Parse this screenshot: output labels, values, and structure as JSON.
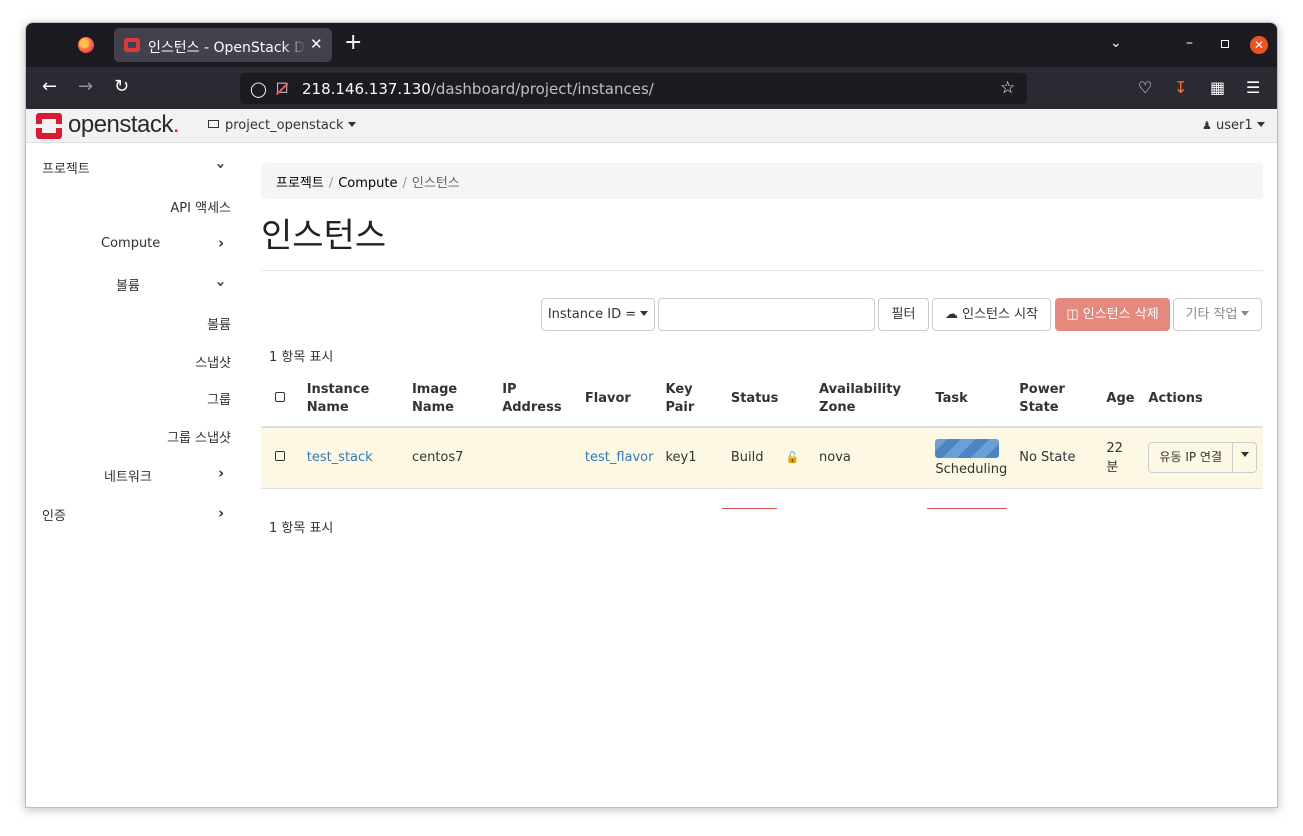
{
  "browser": {
    "tab_title": "인스턴스 - OpenStack Dashboard",
    "close_glyph": "✕",
    "new_tab_glyph": "+",
    "url_host": "218.146.137.130",
    "url_path": "/dashboard/project/instances/"
  },
  "header": {
    "logo": "openstack",
    "logo_dot": ".",
    "project": "project_openstack",
    "user": "user1"
  },
  "sidebar": {
    "project": "프로젝트",
    "api_access": "API 액세스",
    "compute": "Compute",
    "volumes_group": "볼륨",
    "volumes": "볼륨",
    "snapshots": "스냅샷",
    "groups": "그룹",
    "group_snapshots": "그룹 스냅샷",
    "network": "네트워크",
    "identity": "인증"
  },
  "breadcrumb": {
    "item1": "프로젝트",
    "item2": "Compute",
    "item3": "인스턴스",
    "sep": "/"
  },
  "page": {
    "title": "인스턴스",
    "filter_field": "Instance ID =",
    "filter_button": "필터",
    "launch_button": "인스턴스 시작",
    "delete_button": "인스턴스 삭제",
    "more_actions": "기타 작업",
    "count_top": "1 항목 표시",
    "count_bottom": "1 항목 표시"
  },
  "table": {
    "headers": {
      "instance_name": "Instance Name",
      "image_name": "Image Name",
      "ip_address": "IP Address",
      "flavor": "Flavor",
      "key_pair": "Key Pair",
      "status": "Status",
      "availability_zone": "Availability Zone",
      "task": "Task",
      "power_state": "Power State",
      "age": "Age",
      "actions": "Actions"
    },
    "rows": [
      {
        "instance_name": "test_stack",
        "image_name": "centos7",
        "ip_address": "",
        "flavor": "test_flavor",
        "key_pair": "key1",
        "status": "Build",
        "availability_zone": "nova",
        "task": "Scheduling",
        "power_state": "No State",
        "age": "22 분",
        "action": "유동 IP 연결"
      }
    ]
  },
  "colors": {
    "brand_red": "#da1a32",
    "link": "#337ab7",
    "danger": "#e5897f",
    "row_highlight": "#fcf8e3"
  }
}
